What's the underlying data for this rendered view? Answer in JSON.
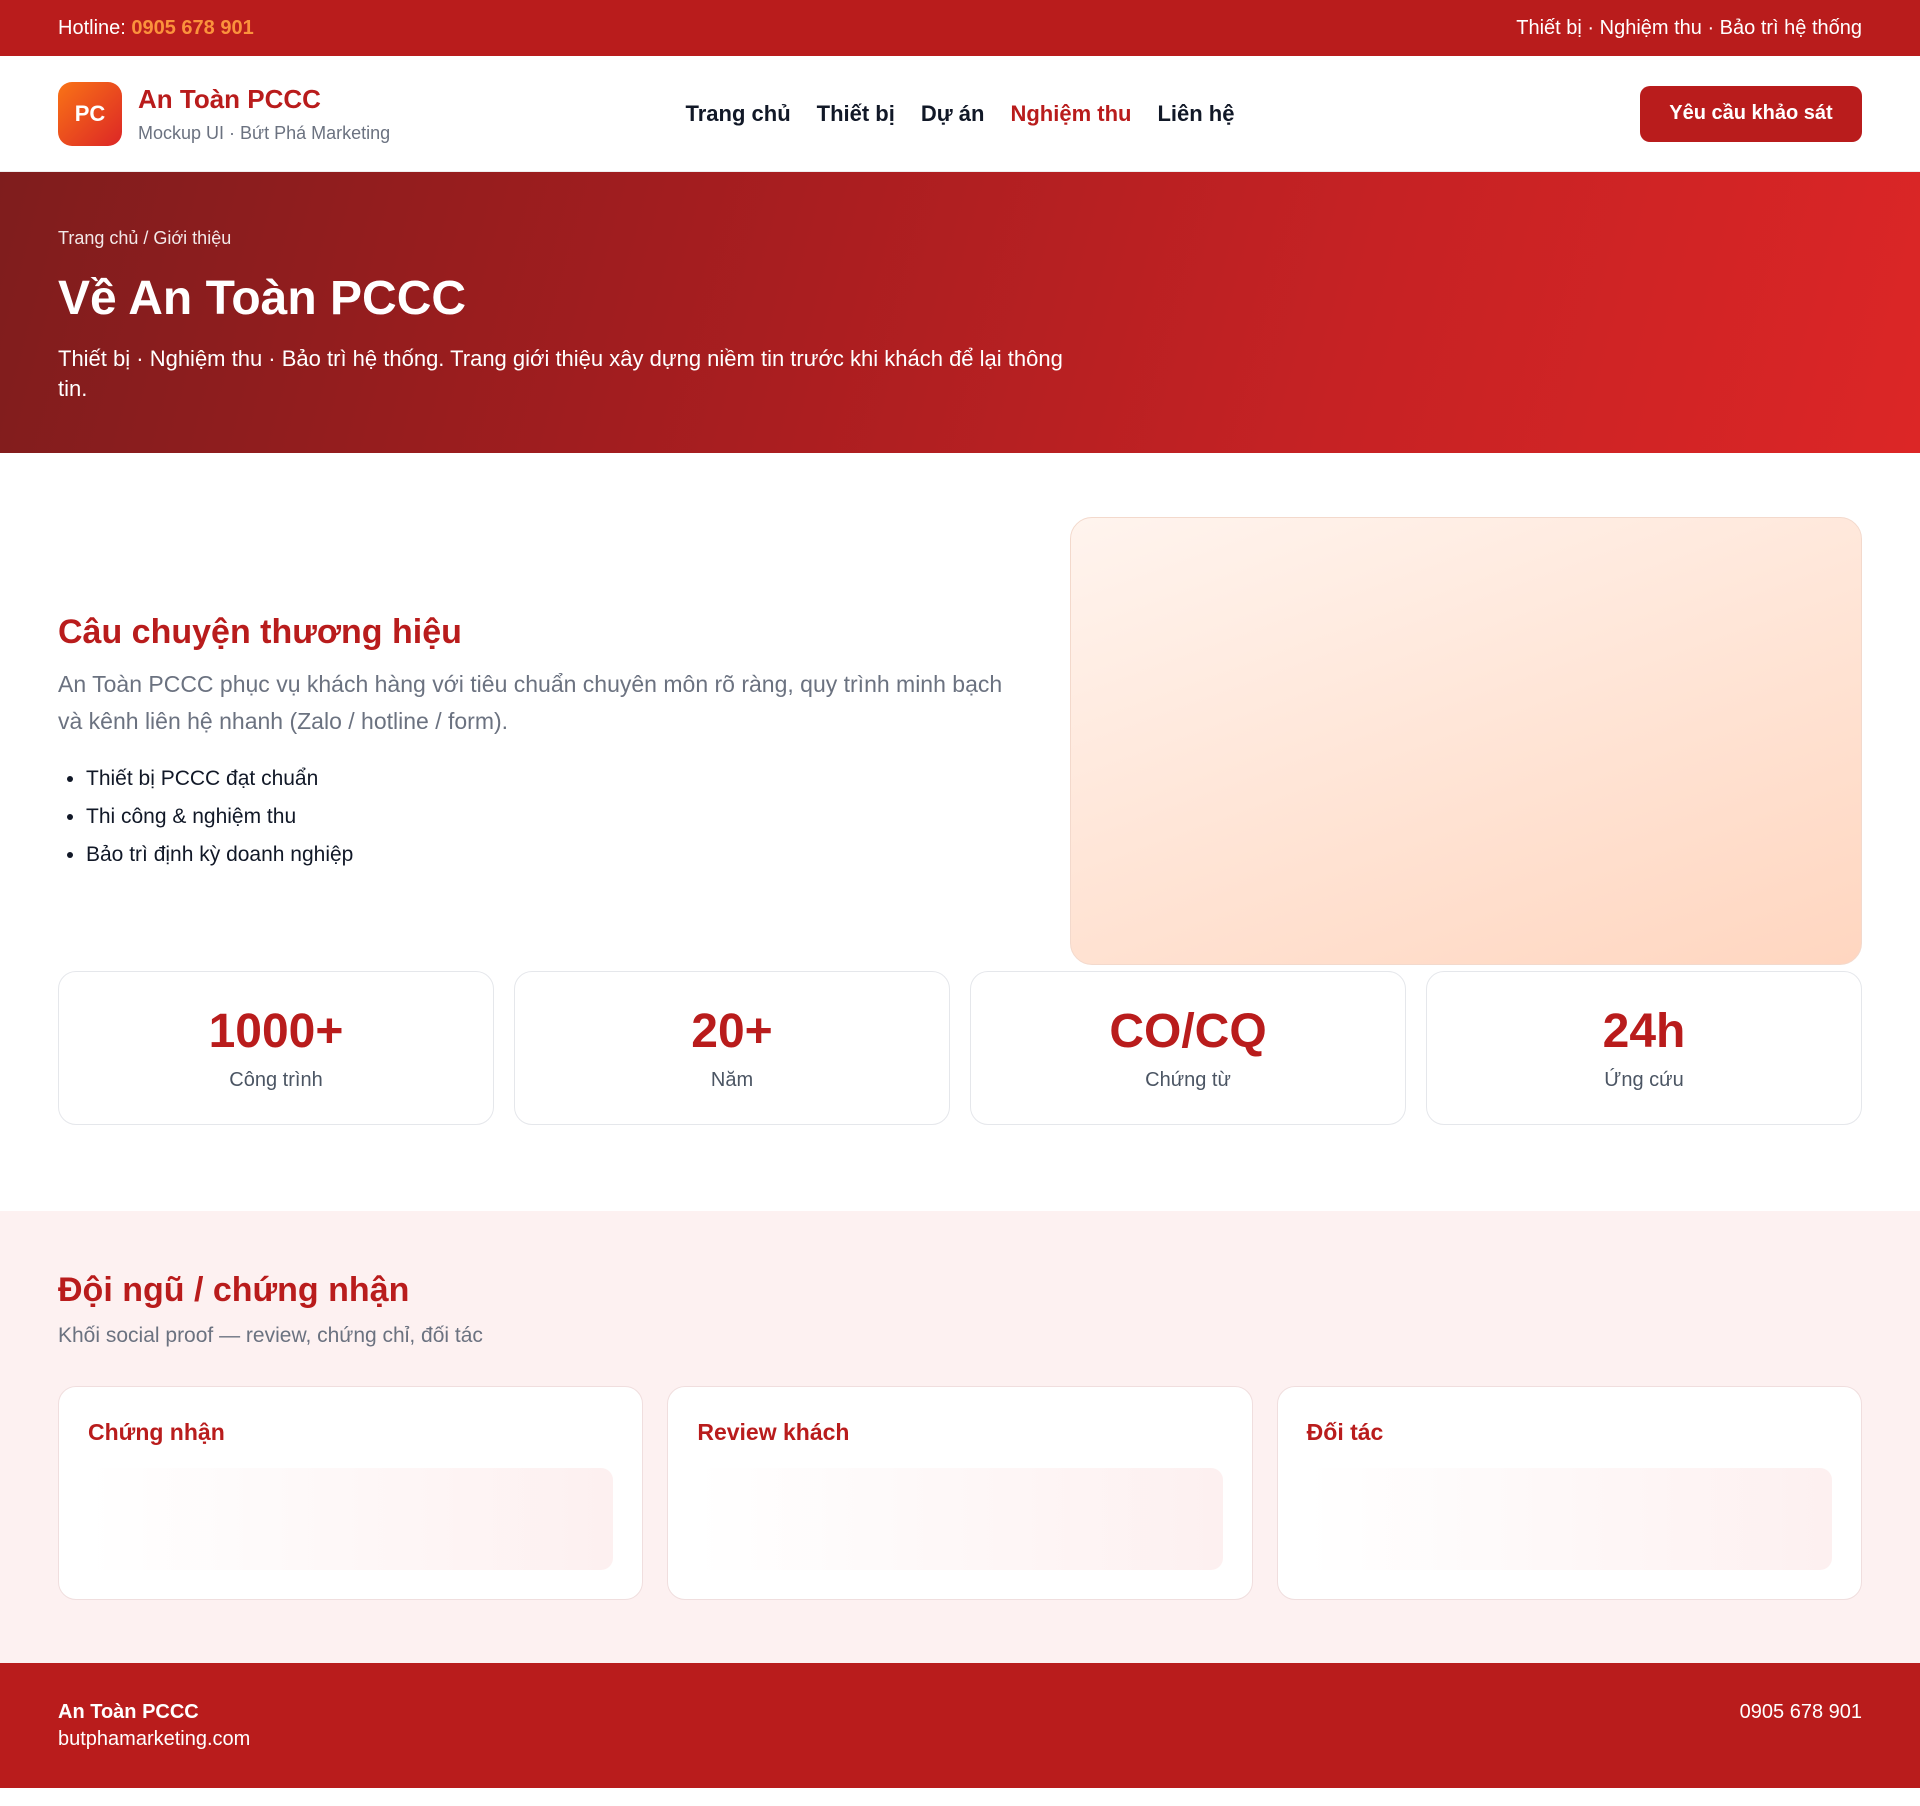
{
  "topbar": {
    "hotline_label": "Hotline:",
    "hotline_number": "0905 678 901",
    "tagline": "Thiết bị · Nghiệm thu · Bảo trì hệ thống"
  },
  "header": {
    "logo_text": "PC",
    "brand_name": "An Toàn PCCC",
    "brand_sub": "Mockup UI · Bứt Phá Marketing",
    "nav": [
      "Trang chủ",
      "Thiết bị",
      "Dự án",
      "Nghiệm thu",
      "Liên hệ"
    ],
    "cta_label": "Yêu cầu khảo sát"
  },
  "hero": {
    "breadcrumb": "Trang chủ / Giới thiệu",
    "title": "Về An Toàn PCCC",
    "description": "Thiết bị · Nghiệm thu · Bảo trì hệ thống. Trang giới thiệu xây dựng niềm tin trước khi khách để lại thông tin."
  },
  "story": {
    "title": "Câu chuyện thương hiệu",
    "description": "An Toàn PCCC phục vụ khách hàng với tiêu chuẩn chuyên môn rõ ràng, quy trình minh bạch và kênh liên hệ nhanh (Zalo / hotline / form).",
    "bullets": [
      "Thiết bị PCCC đạt chuẩn",
      "Thi công & nghiệm thu",
      "Bảo trì định kỳ doanh nghiệp"
    ]
  },
  "stats": [
    {
      "value": "1000+",
      "label": "Công trình"
    },
    {
      "value": "20+",
      "label": "Năm"
    },
    {
      "value": "CO/CQ",
      "label": "Chứng từ"
    },
    {
      "value": "24h",
      "label": "Ứng cứu"
    }
  ],
  "team": {
    "title": "Đội ngũ / chứng nhận",
    "subtitle": "Khối social proof — review, chứng chỉ, đối tác",
    "cards": [
      "Chứng nhận",
      "Review khách",
      "Đối tác"
    ]
  },
  "footer": {
    "name": "An Toàn PCCC",
    "site": "butphamarketing.com",
    "phone": "0905 678 901"
  },
  "colors": {
    "brand_red": "#b91c1c",
    "accent_orange": "#fb923c"
  }
}
